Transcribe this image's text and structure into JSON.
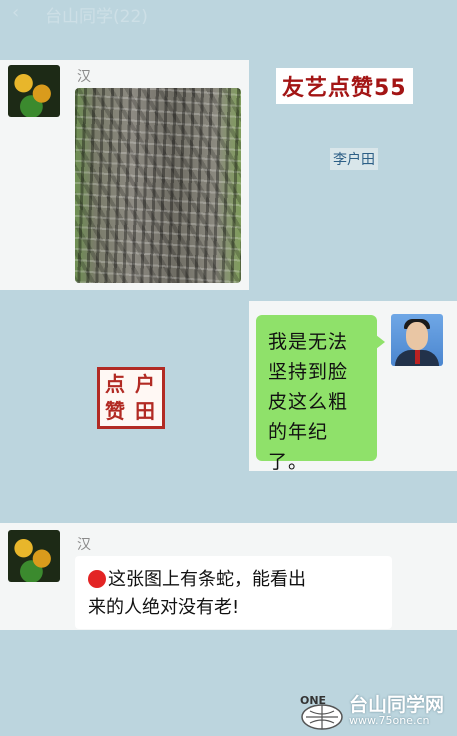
{
  "top_bar": {
    "back_glyph": "‹",
    "title": "台山同学(22)"
  },
  "messages": [
    {
      "sender": "汉",
      "type": "image",
      "image_desc_icon": "tree-bark-image"
    },
    {
      "sender": "",
      "type": "text",
      "text_lines": [
        "我是无法",
        "坚持到脸",
        "皮这么粗",
        "的年纪了。"
      ]
    },
    {
      "sender": "汉",
      "type": "text",
      "text_lines": [
        "这张图上有条蛇，能看出",
        "来的人绝对没有老!"
      ]
    }
  ],
  "overlay": {
    "title": "友艺点赞55",
    "author": "李户田",
    "stamp_chars": [
      "点",
      "户",
      "赞",
      "田"
    ]
  },
  "watermark": {
    "name": "台山同学网",
    "url": "www.75one.cn",
    "logo_text": "ONE"
  },
  "colors": {
    "background": "#bcd5de",
    "green_bubble": "#8fe16a",
    "stamp_red": "#b22a23",
    "title_red": "#a31515"
  }
}
